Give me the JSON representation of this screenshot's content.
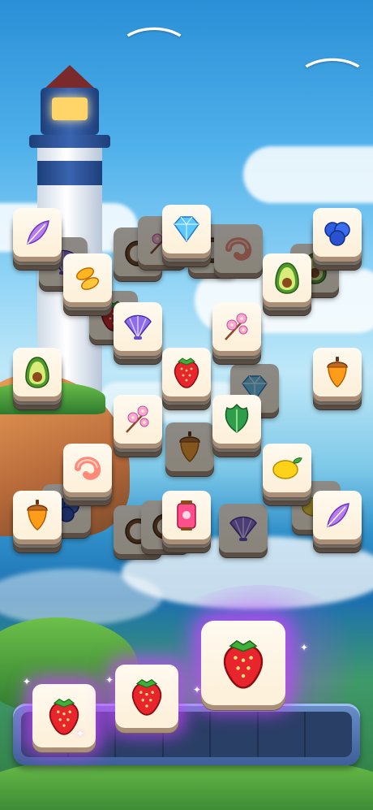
{
  "game": {
    "title": "",
    "theme": "seaside tile match",
    "colors": {
      "tile_face": "#fffaf0",
      "tile_edge": "#a98f78",
      "tray": "#3e5f99",
      "selection_glow": "#c846ff"
    }
  },
  "board": {
    "tiles": [
      {
        "id": "t-feather-tl",
        "icon": "feather-icon",
        "state": "free"
      },
      {
        "id": "t-diamond",
        "icon": "diamond-icon",
        "state": "free"
      },
      {
        "id": "t-blueberry",
        "icon": "blueberry-icon",
        "state": "free"
      },
      {
        "id": "t-goldfish",
        "icon": "goldfish-icon",
        "state": "free"
      },
      {
        "id": "t-avocado-r",
        "icon": "avocado-icon",
        "state": "free"
      },
      {
        "id": "t-shell",
        "icon": "seashell-icon",
        "state": "free"
      },
      {
        "id": "t-blossom-r",
        "icon": "cherry-blossom-icon",
        "state": "free"
      },
      {
        "id": "t-avocado-l",
        "icon": "avocado-icon",
        "state": "free"
      },
      {
        "id": "t-strawberry",
        "icon": "strawberry-icon",
        "state": "free"
      },
      {
        "id": "t-acorn-r",
        "icon": "acorn-icon",
        "state": "free"
      },
      {
        "id": "t-blossom-l",
        "icon": "cherry-blossom-icon",
        "state": "free"
      },
      {
        "id": "t-leaf",
        "icon": "leaf-icon",
        "state": "free"
      },
      {
        "id": "t-shrimp",
        "icon": "shrimp-icon",
        "state": "free"
      },
      {
        "id": "t-lemon",
        "icon": "lemon-icon",
        "state": "free"
      },
      {
        "id": "t-acorn-l",
        "icon": "acorn-icon",
        "state": "free"
      },
      {
        "id": "t-lantern",
        "icon": "lantern-icon",
        "state": "free"
      },
      {
        "id": "t-feather-br",
        "icon": "feather-icon",
        "state": "free"
      },
      {
        "id": "b-coconut-1",
        "icon": "coconut-icon",
        "state": "blocked"
      },
      {
        "id": "b-blossom",
        "icon": "cherry-blossom-icon",
        "state": "blocked"
      },
      {
        "id": "b-coconut-2",
        "icon": "coconut-icon",
        "state": "blocked"
      },
      {
        "id": "b-shrimp",
        "icon": "shrimp-icon",
        "state": "blocked"
      },
      {
        "id": "b-shell",
        "icon": "seashell-icon",
        "state": "blocked"
      },
      {
        "id": "b-avocado",
        "icon": "avocado-icon",
        "state": "blocked"
      },
      {
        "id": "b-strawberry",
        "icon": "strawberry-icon",
        "state": "blocked"
      },
      {
        "id": "b-diamond",
        "icon": "diamond-icon",
        "state": "blocked"
      },
      {
        "id": "b-acorn",
        "icon": "acorn-icon",
        "state": "blocked"
      },
      {
        "id": "b-coconut-3",
        "icon": "coconut-icon",
        "state": "blocked"
      },
      {
        "id": "b-coconut-4",
        "icon": "coconut-icon",
        "state": "blocked"
      },
      {
        "id": "b-shell-2",
        "icon": "seashell-icon",
        "state": "blocked"
      },
      {
        "id": "b-lemon",
        "icon": "lemon-icon",
        "state": "blocked"
      },
      {
        "id": "b-blueberry",
        "icon": "blueberry-icon",
        "state": "blocked"
      }
    ]
  },
  "tray": {
    "capacity": 7,
    "slots_filled": 3,
    "collected": [
      {
        "icon": "strawberry-icon"
      },
      {
        "icon": "strawberry-icon"
      },
      {
        "icon": "strawberry-icon"
      }
    ]
  }
}
